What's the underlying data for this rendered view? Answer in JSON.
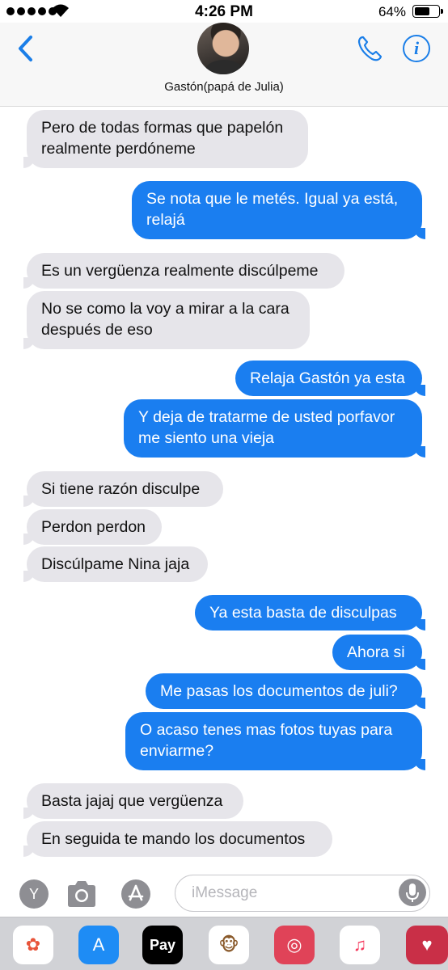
{
  "status": {
    "time": "4:26 PM",
    "battery": "64%",
    "battery_level": 0.64
  },
  "header": {
    "contact_name": "Gastón(papá de Julia)"
  },
  "colors": {
    "accent": "#1a7ee8",
    "outgoing": "#1a7ef0",
    "incoming": "#e6e5ea"
  },
  "messages": [
    {
      "dir": "in",
      "lines": [
        "Pero de todas formas que papelón",
        "realmente perdóneme"
      ]
    },
    {
      "dir": "out",
      "lines": [
        "Se nota que le metés. Igual ya está,",
        "relajá"
      ]
    },
    {
      "dir": "in",
      "lines": [
        "Es un vergüenza realmente discúlpeme"
      ]
    },
    {
      "dir": "in",
      "lines": [
        "No se como la voy a mirar a la cara",
        "después de eso"
      ]
    },
    {
      "dir": "out",
      "lines": [
        "Relaja Gastón ya esta"
      ]
    },
    {
      "dir": "out",
      "lines": [
        "Y deja de tratarme de usted porfavor",
        "me siento una vieja"
      ]
    },
    {
      "dir": "in",
      "lines": [
        "Si tiene razón disculpe"
      ]
    },
    {
      "dir": "in",
      "lines": [
        "Perdon perdon"
      ]
    },
    {
      "dir": "in",
      "lines": [
        "Discúlpame Nina jaja"
      ]
    },
    {
      "dir": "out",
      "lines": [
        "Ya esta basta de disculpas"
      ]
    },
    {
      "dir": "out",
      "lines": [
        "Ahora si"
      ]
    },
    {
      "dir": "out",
      "lines": [
        "Me pasas los documentos de juli?"
      ]
    },
    {
      "dir": "out",
      "lines": [
        "O  acaso tenes mas fotos tuyas para",
        "enviarme?"
      ]
    },
    {
      "dir": "in",
      "lines": [
        "Basta jajaj que vergüenza"
      ]
    },
    {
      "dir": "in",
      "lines": [
        "En seguida te mando los documentos"
      ]
    }
  ],
  "input": {
    "placeholder": "iMessage",
    "left_button": "Y"
  },
  "drawer": {
    "apps": [
      {
        "name": "photos-app-icon",
        "glyph": "✿",
        "bg": "#ffffff",
        "fg": "#e8543a"
      },
      {
        "name": "app-store-icon",
        "glyph": "A",
        "bg": "#1e8cf5",
        "fg": "#ffffff"
      },
      {
        "name": "apple-pay-icon",
        "glyph": "Pay",
        "bg": "#000000",
        "fg": "#ffffff"
      },
      {
        "name": "monkey-sticker-icon",
        "glyph": "🐵",
        "bg": "#ffffff",
        "fg": "#8a5a2b"
      },
      {
        "name": "search-images-icon",
        "glyph": "◎",
        "bg": "#e04358",
        "fg": "#ffffff"
      },
      {
        "name": "music-icon",
        "glyph": "♫",
        "bg": "#ffffff",
        "fg": "#f5385c"
      },
      {
        "name": "digital-touch-icon",
        "glyph": "♥",
        "bg": "#c92f47",
        "fg": "#ffffff"
      }
    ]
  }
}
